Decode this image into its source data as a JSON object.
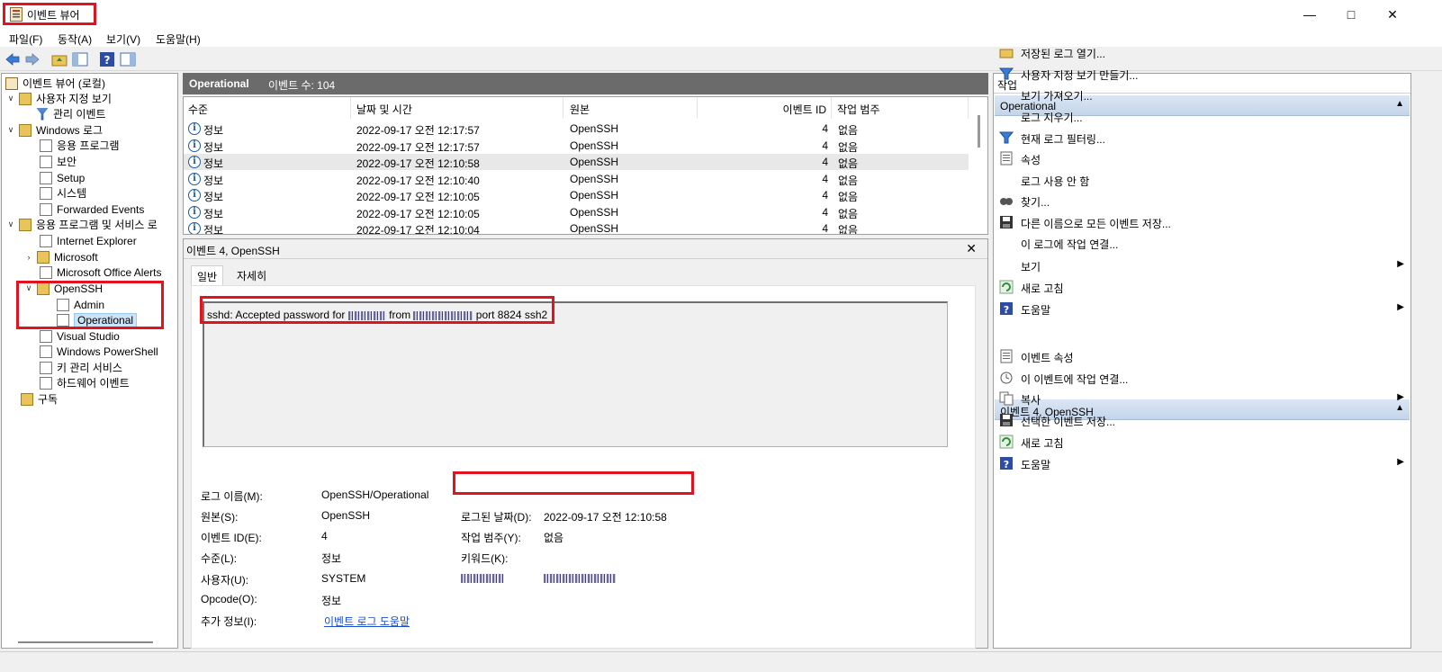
{
  "window": {
    "title": "이벤트 뷰어"
  },
  "menu": [
    "파일(F)",
    "동작(A)",
    "보기(V)",
    "도움말(H)"
  ],
  "tree": {
    "root": "이벤트 뷰어 (로컬)",
    "custom_views": "사용자 지정 보기",
    "admin_events": "관리 이벤트",
    "windows_logs": "Windows 로그",
    "app": "응용 프로그램",
    "security": "보안",
    "setup": "Setup",
    "system": "시스템",
    "forwarded": "Forwarded Events",
    "apps_services": "응용 프로그램 및 서비스 로",
    "ie": "Internet Explorer",
    "microsoft": "Microsoft",
    "office_alerts": "Microsoft Office Alerts",
    "openssh": "OpenSSH",
    "admin": "Admin",
    "operational": "Operational",
    "visual_studio": "Visual Studio",
    "powershell": "Windows PowerShell",
    "key_mgmt": "키 관리 서비스",
    "hardware": "하드웨어 이벤트",
    "subscriptions": "구독"
  },
  "list": {
    "title": "Operational",
    "count_label": "이벤트 수: 104",
    "columns": [
      "수준",
      "날짜 및 시간",
      "원본",
      "이벤트 ID",
      "작업 범주"
    ],
    "rows": [
      {
        "level": "정보",
        "datetime": "2022-09-17 오전 12:17:57",
        "source": "OpenSSH",
        "id": "4",
        "category": "없음"
      },
      {
        "level": "정보",
        "datetime": "2022-09-17 오전 12:17:57",
        "source": "OpenSSH",
        "id": "4",
        "category": "없음"
      },
      {
        "level": "정보",
        "datetime": "2022-09-17 오전 12:10:58",
        "source": "OpenSSH",
        "id": "4",
        "category": "없음"
      },
      {
        "level": "정보",
        "datetime": "2022-09-17 오전 12:10:40",
        "source": "OpenSSH",
        "id": "4",
        "category": "없음"
      },
      {
        "level": "정보",
        "datetime": "2022-09-17 오전 12:10:05",
        "source": "OpenSSH",
        "id": "4",
        "category": "없음"
      },
      {
        "level": "정보",
        "datetime": "2022-09-17 오전 12:10:05",
        "source": "OpenSSH",
        "id": "4",
        "category": "없음"
      },
      {
        "level": "정보",
        "datetime": "2022-09-17 오전 12:10:04",
        "source": "OpenSSH",
        "id": "4",
        "category": "없음"
      }
    ]
  },
  "detail": {
    "title": "이벤트 4, OpenSSH",
    "tabs": [
      "일반",
      "자세히"
    ],
    "msg_a": "sshd: Accepted password for",
    "msg_b": "from",
    "msg_c": "port 8824 ssh2",
    "log_name_label": "로그 이름(M):",
    "log_name": "OpenSSH/Operational",
    "source_label": "원본(S):",
    "source": "OpenSSH",
    "event_id_label": "이벤트 ID(E):",
    "event_id": "4",
    "level_label": "수준(L):",
    "level": "정보",
    "user_label": "사용자(U):",
    "user": "SYSTEM",
    "opcode_label": "Opcode(O):",
    "opcode": "정보",
    "more_label": "추가 정보(I):",
    "more_link": "이벤트 로그 도움말",
    "logged_label": "로그된 날짜(D):",
    "logged": "2022-09-17 오전 12:10:58",
    "task_label": "작업 범주(Y):",
    "task": "없음",
    "keywords_label": "키워드(K):"
  },
  "actions": {
    "title": "작업",
    "section1": "Operational",
    "items1": [
      "저장된 로그 열기...",
      "사용자 지정 보기 만들기...",
      "보기 가져오기...",
      "로그 지우기...",
      "현재 로그 필터링...",
      "속성",
      "로그 사용 안 함",
      "찾기...",
      "다른 이름으로 모든 이벤트 저장...",
      "이 로그에 작업 연결...",
      "보기",
      "새로 고침",
      "도움말"
    ],
    "section2": "이벤트 4, OpenSSH",
    "items2": [
      "이벤트 속성",
      "이 이벤트에 작업 연결...",
      "복사",
      "선택한 이벤트 저장...",
      "새로 고침",
      "도움말"
    ]
  }
}
